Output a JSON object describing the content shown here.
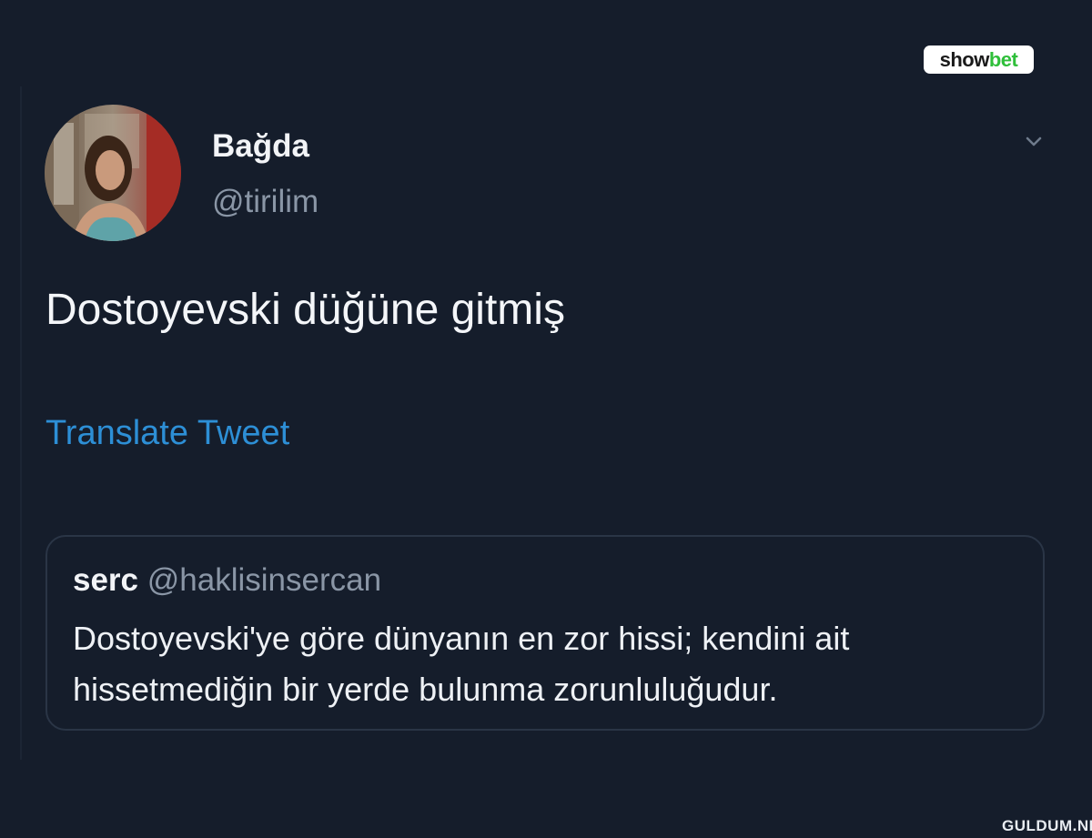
{
  "brand": {
    "word_1": "show",
    "word_2": "bet"
  },
  "tweet": {
    "author_name": "Bağda",
    "author_handle": "@tirilim",
    "text": "Dostoyevski düğüne gitmiş",
    "translate_label": "Translate Tweet",
    "menu_icon": "chevron-down-icon"
  },
  "quoted_tweet": {
    "author_name": "serc",
    "author_handle": "@haklisinsercan",
    "text": "Dostoyevski'ye göre dünyanın en zor hissi; kendini ait hissetmediğin bir yerde bulunma zorunluluğudur."
  },
  "watermark": "GULDUM.NET",
  "colors": {
    "background": "#151d2b",
    "link": "#2d8fd6",
    "muted": "#8a96a6",
    "text": "#f2f4f7",
    "brand_accent": "#2fbf3a"
  }
}
